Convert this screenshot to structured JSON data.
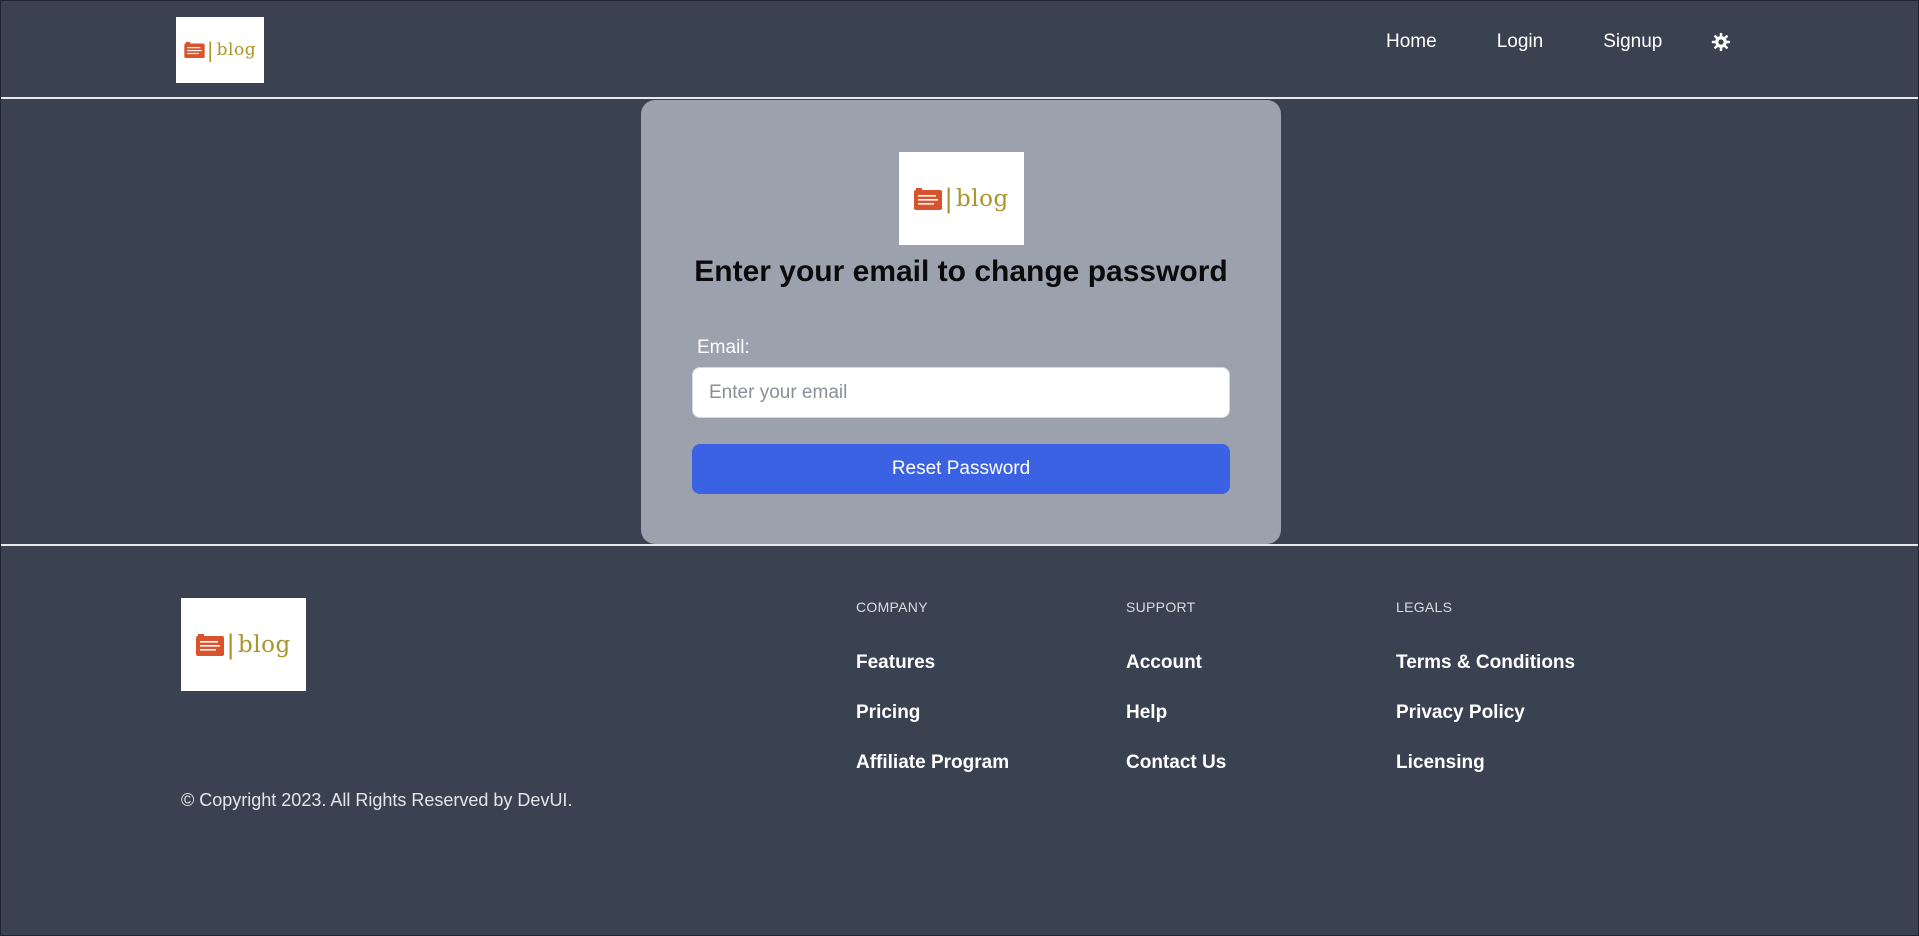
{
  "brand": {
    "logo_text": "blog",
    "logo_separator": "|",
    "icon": "newspaper-icon"
  },
  "header": {
    "nav": {
      "home": "Home",
      "login": "Login",
      "signup": "Signup"
    },
    "theme_icon": "sun-gear-icon"
  },
  "reset_form": {
    "title": "Enter your email to change password",
    "email_label": "Email:",
    "email_placeholder": "Enter your email",
    "email_value": "",
    "submit_label": "Reset Password"
  },
  "footer": {
    "copyright": "© Copyright 2023. All Rights Reserved by DevUI.",
    "columns": [
      {
        "heading": "COMPANY",
        "links": [
          "Features",
          "Pricing",
          "Affiliate Program"
        ]
      },
      {
        "heading": "SUPPORT",
        "links": [
          "Account",
          "Help",
          "Contact Us"
        ]
      },
      {
        "heading": "LEGALS",
        "links": [
          "Terms & Conditions",
          "Privacy Policy",
          "Licensing"
        ]
      }
    ]
  },
  "colors": {
    "background": "#3a4151",
    "card": "#9ba2ae",
    "primary_button": "#3a62e3",
    "logo_text": "#a8962a",
    "logo_icon": "#d9532c"
  }
}
